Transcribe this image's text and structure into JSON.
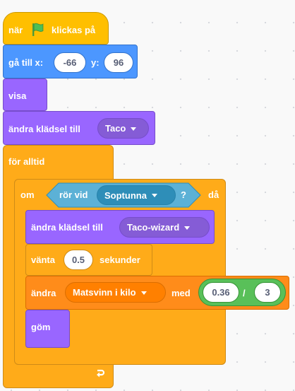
{
  "colors": {
    "events": "#ffbf00",
    "motion": "#4c97ff",
    "looks": "#9966ff",
    "control": "#ffab19",
    "sensing": "#5cb1d6",
    "variables": "#ff8c1a",
    "operators": "#59c059"
  },
  "script": {
    "hat": {
      "pre": "när",
      "icon": "green-flag-icon",
      "post": "klickas på"
    },
    "goto": {
      "label": "gå till x:",
      "x": "-66",
      "y_label": "y:",
      "y": "96"
    },
    "show": {
      "label": "visa"
    },
    "switch1": {
      "label": "ändra klädsel till",
      "costume": "Taco"
    },
    "forever": {
      "label": "för alltid"
    },
    "if": {
      "label": "om",
      "then": "då",
      "condition": {
        "label": "rör vid",
        "target": "Soptunna",
        "q": "?"
      }
    },
    "switch2": {
      "label": "ändra klädsel till",
      "costume": "Taco-wizard"
    },
    "wait": {
      "label": "vänta",
      "value": "0.5",
      "unit": "sekunder"
    },
    "change": {
      "label": "ändra",
      "variable": "Matsvinn i kilo",
      "with": "med",
      "num": "0.36",
      "op": "/",
      "den": "3"
    },
    "hide": {
      "label": "göm"
    }
  }
}
